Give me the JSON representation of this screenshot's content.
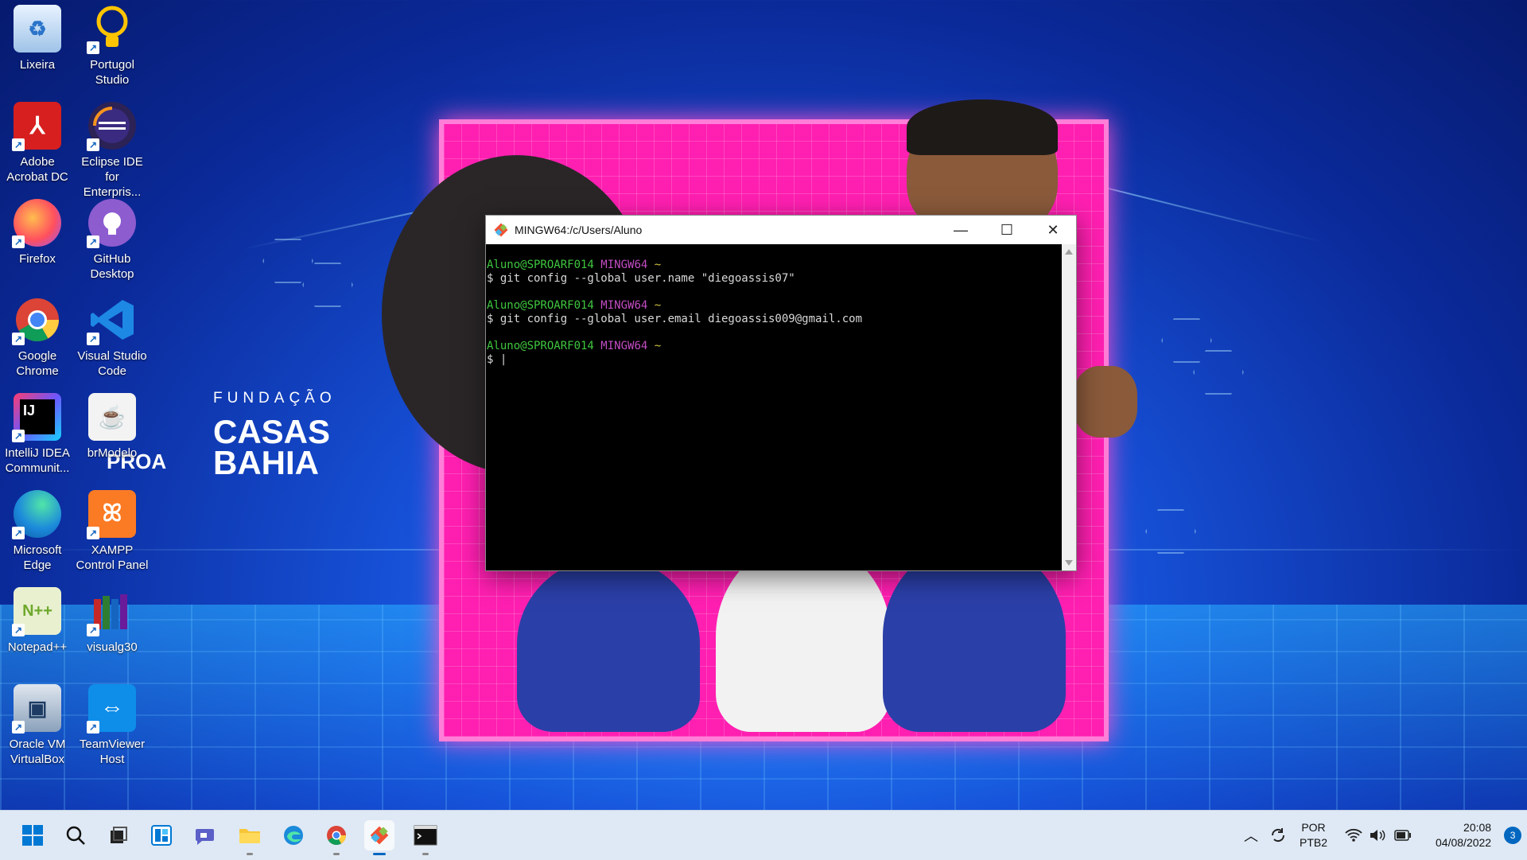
{
  "desktop": {
    "brand": {
      "line1": "FUNDAÇÃO",
      "line2": "CASAS",
      "line3": "BAHIA",
      "proa": "PROA"
    },
    "icons": [
      {
        "label": "Lixeira",
        "icon": "recycle-bin-icon"
      },
      {
        "label": "Portugol Studio",
        "icon": "lightbulb-icon"
      },
      {
        "label": "Adobe Acrobat DC",
        "icon": "acrobat-icon"
      },
      {
        "label": "Eclipse IDE for Enterpris...",
        "icon": "eclipse-icon"
      },
      {
        "label": "Firefox",
        "icon": "firefox-icon"
      },
      {
        "label": "GitHub Desktop",
        "icon": "github-icon"
      },
      {
        "label": "Google Chrome",
        "icon": "chrome-icon"
      },
      {
        "label": "Visual Studio Code",
        "icon": "vscode-icon"
      },
      {
        "label": "IntelliJ IDEA Communit...",
        "icon": "intellij-icon"
      },
      {
        "label": "brModelo",
        "icon": "java-icon"
      },
      {
        "label": "Microsoft Edge",
        "icon": "edge-icon"
      },
      {
        "label": "XAMPP Control Panel",
        "icon": "xampp-icon"
      },
      {
        "label": "Notepad++",
        "icon": "notepadpp-icon"
      },
      {
        "label": "visualg30",
        "icon": "visualg-icon"
      },
      {
        "label": "Oracle VM VirtualBox",
        "icon": "virtualbox-icon"
      },
      {
        "label": "TeamViewer Host",
        "icon": "teamviewer-icon"
      }
    ]
  },
  "window": {
    "title": "MINGW64:/c/Users/Aluno",
    "prompt_user": "Aluno@SPROARF014",
    "prompt_env": "MINGW64",
    "prompt_path": "~",
    "commands": [
      "$ git config --global user.name \"diegoassis07\"",
      "$ git config --global user.email diegoassis009@gmail.com",
      "$ |"
    ],
    "buttons": {
      "minimize": "—",
      "maximize": "☐",
      "close": "✕"
    }
  },
  "taskbar": {
    "apps": [
      "start",
      "search",
      "task-view",
      "widgets",
      "chat",
      "file-explorer",
      "edge",
      "chrome",
      "git-bash",
      "terminal"
    ],
    "lang_top": "POR",
    "lang_bottom": "PTB2",
    "time": "20:08",
    "date": "04/08/2022",
    "notifications": "3",
    "colors": {
      "accent": "#0067c0",
      "taskbar_bg": "#dfe9f5"
    }
  }
}
